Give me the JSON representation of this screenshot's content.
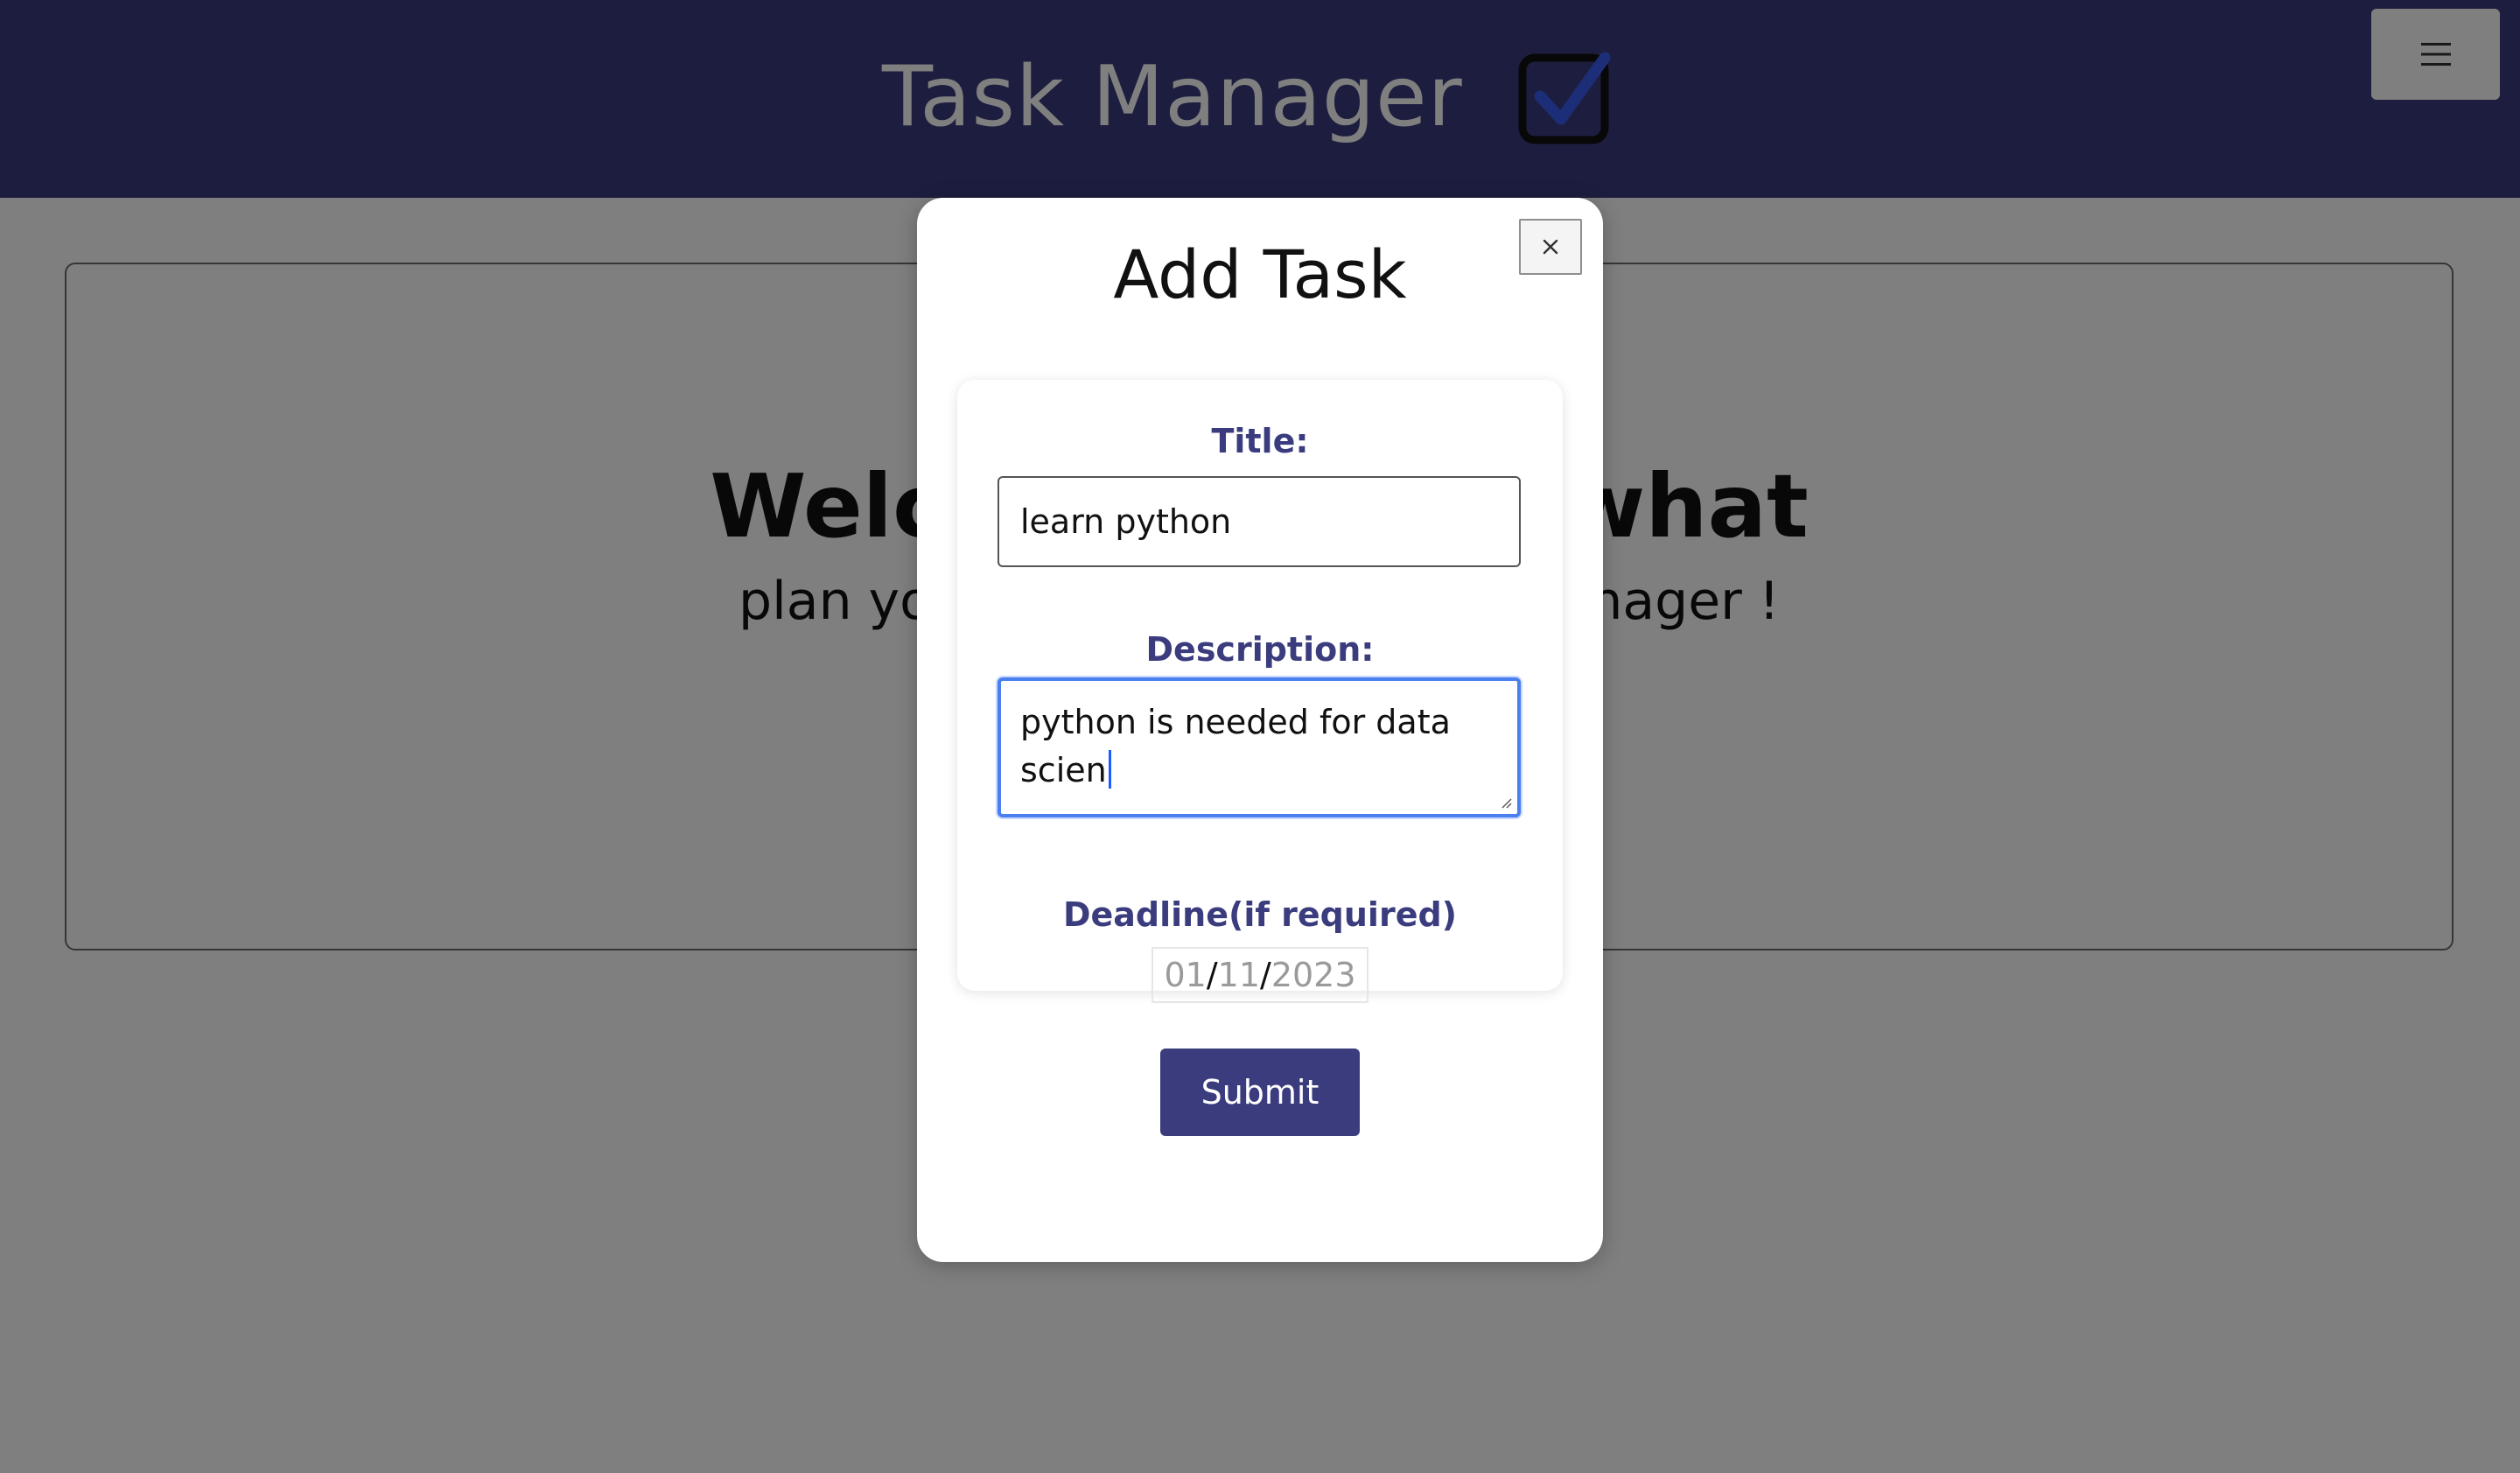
{
  "header": {
    "brand_title": "Task Manager",
    "brand_icon": "checkbox-checked-icon",
    "menu_icon": "hamburger-menu-icon"
  },
  "welcome": {
    "heading": "Welcome to wot, what",
    "subheading": "plan your work with our task manager !"
  },
  "modal": {
    "title": "Add Task",
    "close_icon": "close-icon",
    "form": {
      "title_label": "Title:",
      "title_value": "learn python",
      "description_label": "Description:",
      "description_value": "python is needed for data scien",
      "deadline_label": "Deadline(if required)",
      "deadline": {
        "day": "01",
        "month": "11",
        "year": "2023",
        "separator": "/"
      },
      "submit_label": "Submit"
    }
  },
  "colors": {
    "navbar": "#3b3c7e",
    "label": "#3b3c7e",
    "button": "#3b3c7e",
    "focus_ring": "#4a7ff0",
    "check_accent": "#3a5cf0"
  }
}
